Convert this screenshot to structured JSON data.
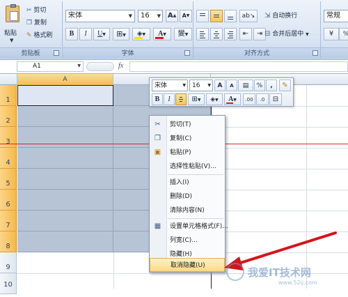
{
  "clipboard": {
    "paste_label": "粘贴",
    "cut_label": "剪切",
    "copy_label": "复制",
    "format_painter_label": "格式刷",
    "group_label": "剪贴板"
  },
  "font": {
    "name": "宋体",
    "size": "16",
    "bold": "B",
    "italic": "I",
    "underline": "U",
    "grow": "A",
    "shrink": "A",
    "font_color_letter": "A",
    "phonetic_char": "變",
    "group_label": "字体"
  },
  "alignment": {
    "wrap_label": "自动换行",
    "merge_label": "合并后居中",
    "group_label": "对齐方式"
  },
  "number": {
    "format": "常规"
  },
  "formula_bar": {
    "name_box": "A1",
    "fx": "fx"
  },
  "grid": {
    "columns": [
      "A"
    ],
    "rows": [
      "1",
      "2",
      "3",
      "4",
      "5",
      "6",
      "7",
      "8",
      "9",
      "10"
    ]
  },
  "mini_toolbar": {
    "font": "宋体",
    "size": "16",
    "percent": "%",
    "comma": ",",
    "bold": "B",
    "italic": "I",
    "font_color_letter": "A"
  },
  "context_menu": {
    "items": [
      "剪切(T)",
      "复制(C)",
      "粘贴(P)",
      "选择性粘贴(V)...",
      "插入(I)",
      "删除(D)",
      "清除内容(N)",
      "设置单元格格式(F)...",
      "列宽(C)...",
      "隐藏(H)",
      "取消隐藏(U)"
    ]
  },
  "colors": {
    "selection": "#b7c4d6",
    "row_header_selected": "#f6b948",
    "highlight": "#fbd983",
    "annotation_arrow": "#d4141a",
    "annotation_line": "#d9252a"
  }
}
